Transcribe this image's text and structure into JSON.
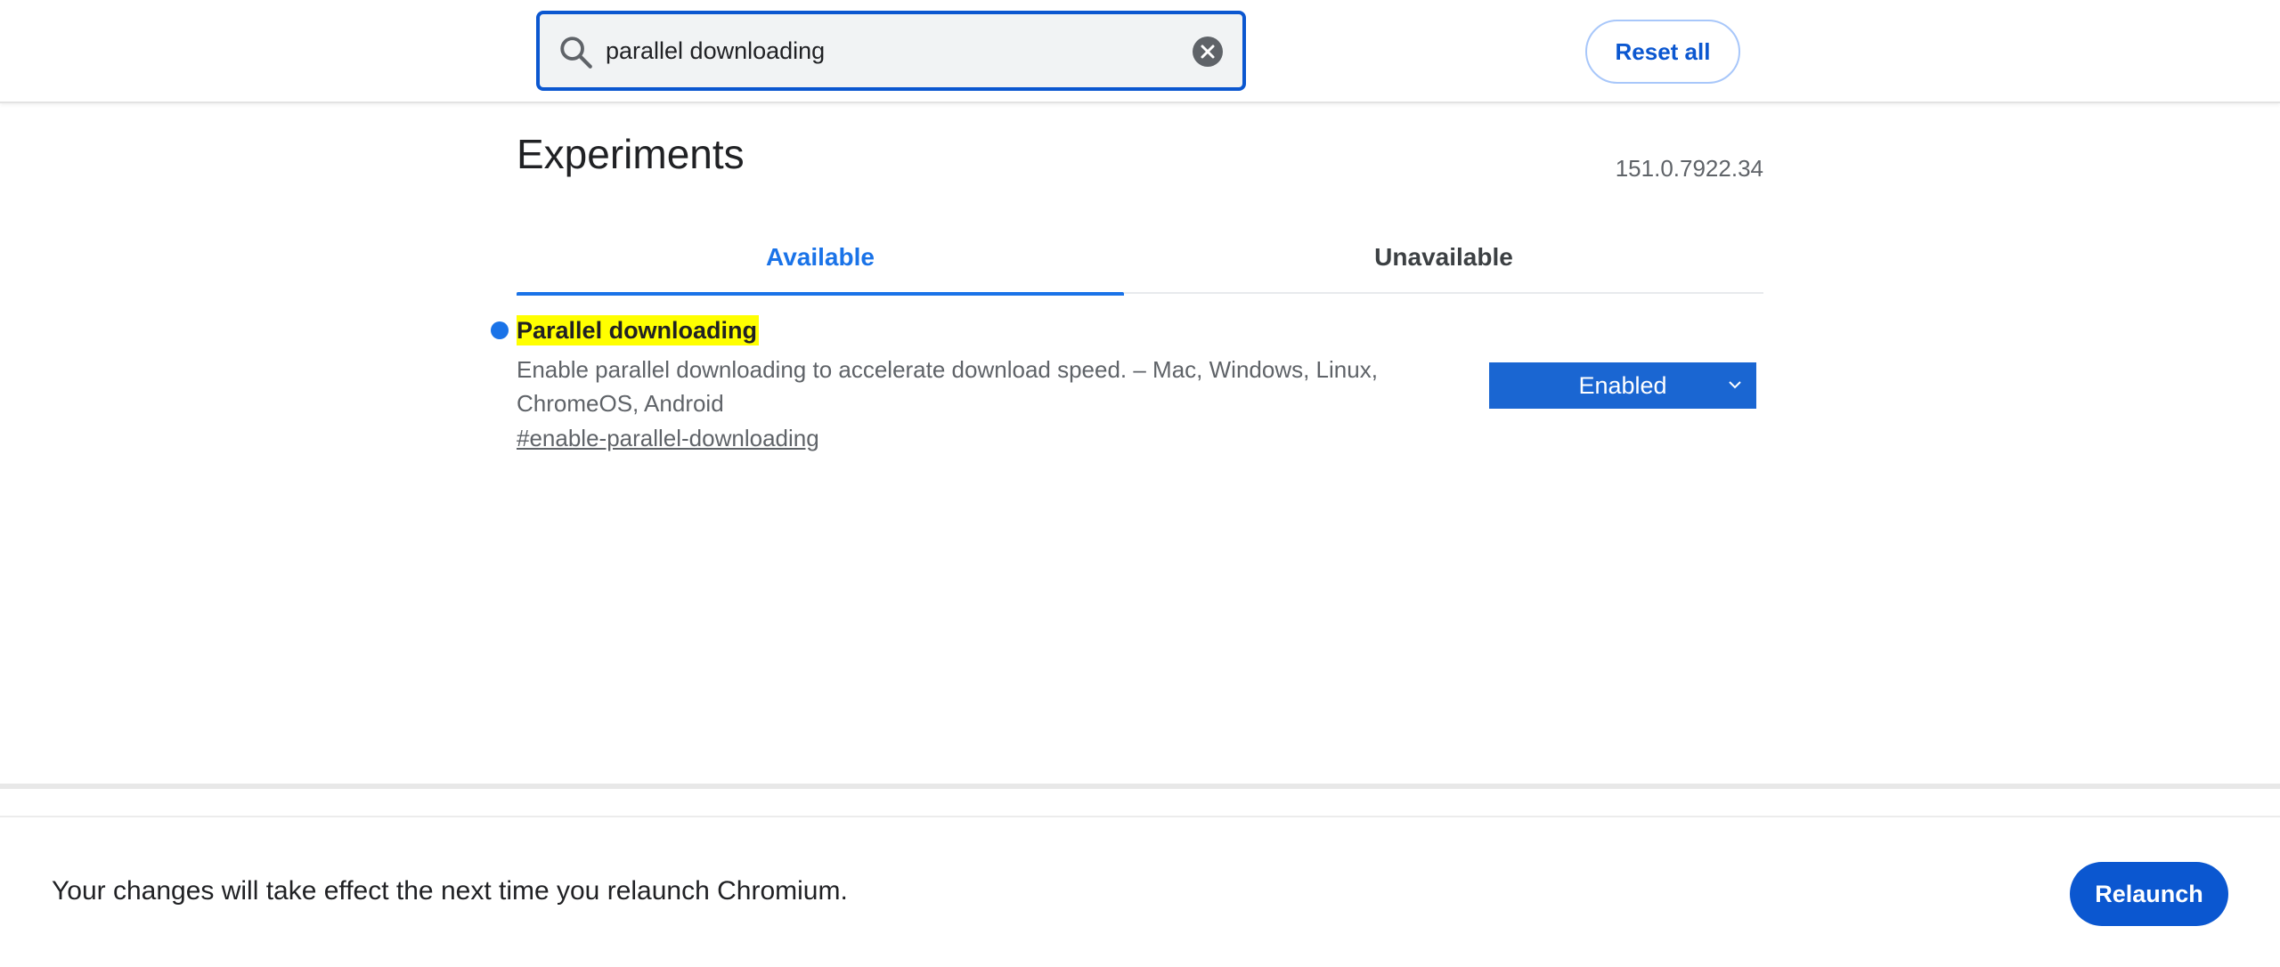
{
  "search": {
    "value": "parallel downloading"
  },
  "header": {
    "reset_label": "Reset all"
  },
  "main": {
    "title": "Experiments",
    "version": "151.0.7922.34",
    "tabs": [
      {
        "label": "Available",
        "active": true
      },
      {
        "label": "Unavailable",
        "active": false
      }
    ]
  },
  "experiment": {
    "title": "Parallel downloading",
    "description": "Enable parallel downloading to accelerate download speed. – Mac, Windows, Linux, ChromeOS, Android",
    "link": "#enable-parallel-downloading",
    "selected_option": "Enabled"
  },
  "footer": {
    "message": "Your changes will take effect the next time you relaunch Chromium.",
    "relaunch_label": "Relaunch"
  },
  "colors": {
    "accent": "#1a73e8",
    "primary_button": "#0b57d0",
    "highlight": "#ffff00"
  },
  "icons": {
    "search": "search-icon",
    "clear": "clear-icon",
    "dropdown": "chevron-down-icon",
    "modified_indicator": "modified-dot-icon"
  }
}
